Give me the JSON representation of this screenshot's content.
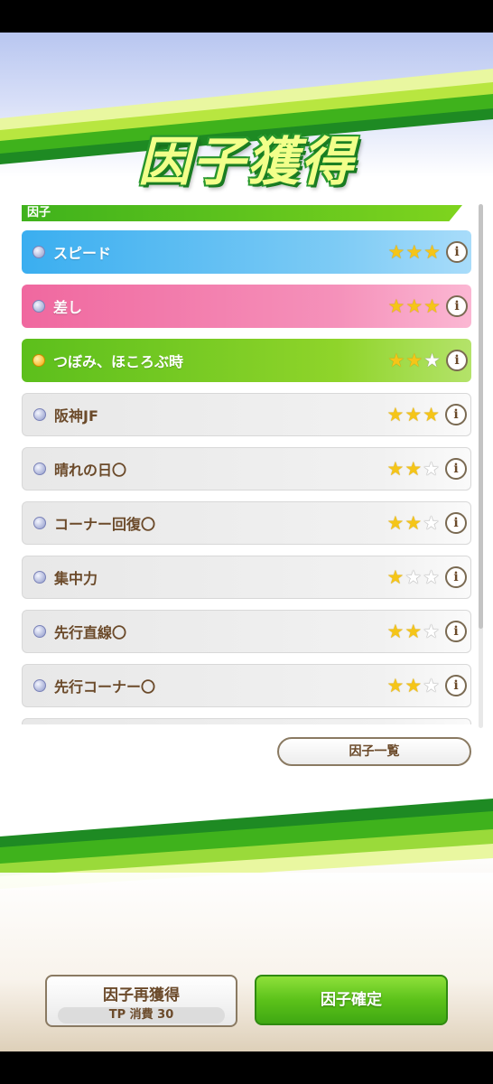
{
  "title": "因子獲得",
  "section_label": "因子",
  "factors": [
    {
      "name": "スピード",
      "stars": 3,
      "theme": "blue",
      "dot": "blue",
      "info": "i"
    },
    {
      "name": "差し",
      "stars": 3,
      "theme": "pink",
      "dot": "blue",
      "info": "i"
    },
    {
      "name": "つぼみ、ほころぶ時",
      "stars": 2,
      "theme": "green",
      "dot": "gold",
      "info": "i"
    },
    {
      "name": "阪神JF",
      "stars": 3,
      "theme": "white",
      "dot": "blue",
      "info": "i"
    },
    {
      "name": "晴れの日〇",
      "stars": 2,
      "theme": "white",
      "dot": "blue",
      "info": "i"
    },
    {
      "name": "コーナー回復〇",
      "stars": 2,
      "theme": "white",
      "dot": "blue",
      "info": "i"
    },
    {
      "name": "集中力",
      "stars": 1,
      "theme": "white",
      "dot": "blue",
      "info": "i"
    },
    {
      "name": "先行直線〇",
      "stars": 2,
      "theme": "white",
      "dot": "blue",
      "info": "i"
    },
    {
      "name": "先行コーナー〇",
      "stars": 2,
      "theme": "white",
      "dot": "blue",
      "info": "i"
    },
    {
      "name": "",
      "stars": 0,
      "theme": "white",
      "dot": "none",
      "info": ""
    }
  ],
  "max_stars": 3,
  "factor_list_button": "因子一覧",
  "regain_button": {
    "label": "因子再獲得",
    "cost": "TP 消費 30"
  },
  "confirm_button": "因子確定",
  "colors": {
    "accent_green": "#5cc21a",
    "skill_blue": "#3aaef0",
    "skill_pink": "#f0689f",
    "skill_green": "#5cbf1c",
    "star": "#f5c518",
    "text_brown": "#6b4a2a"
  }
}
